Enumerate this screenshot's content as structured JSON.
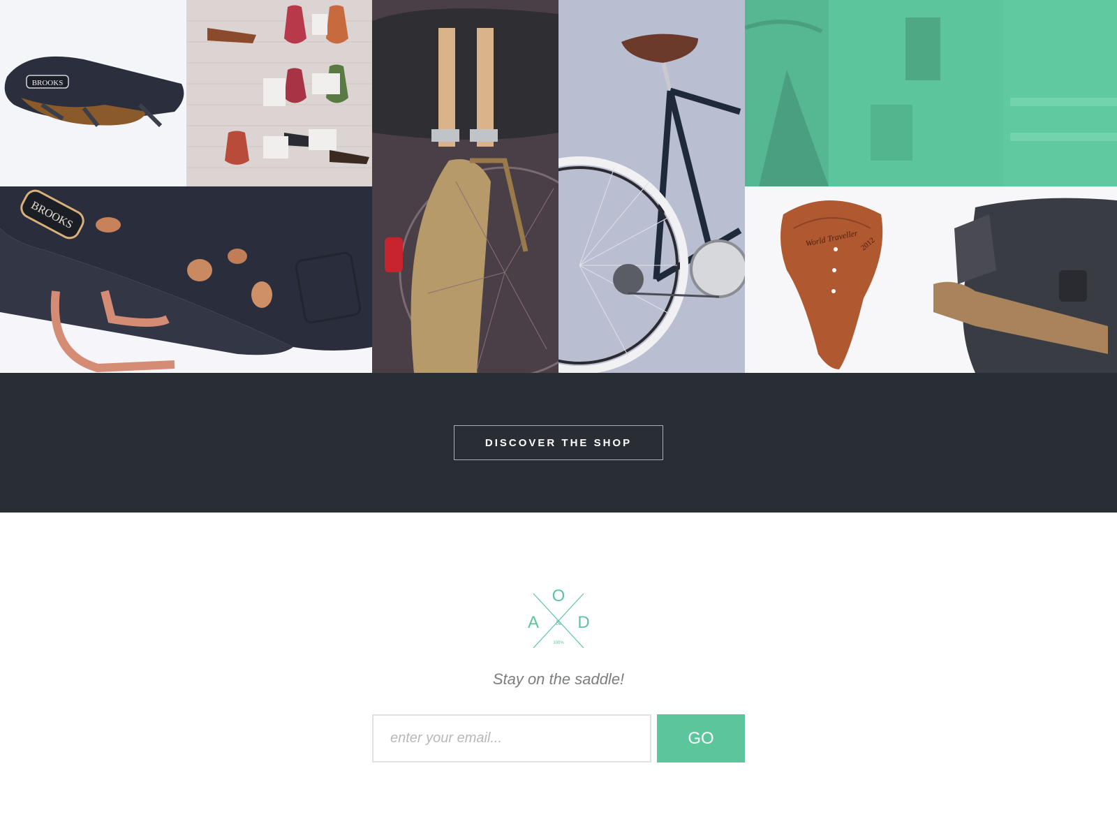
{
  "gallery": {
    "tiles": [
      {
        "subject": "black leather saddle with brand plate",
        "brand_text": "BROOKS"
      },
      {
        "subject": "wall display of coloured saddles"
      },
      {
        "subject": "bicycle rear rack with canvas bag and straps"
      },
      {
        "subject": "road bicycle with brown leather saddle"
      },
      {
        "subject": "shop interior with green overlay"
      },
      {
        "subject": "close-up of black saddle with copper rivets",
        "brand_text": "BROOKS"
      },
      {
        "subject": "copper saddle and waxed canvas messenger bag",
        "engraving_text": "World Traveller",
        "engraving_year": "2012"
      }
    ]
  },
  "cta": {
    "shop_label": "DISCOVER THE SHOP"
  },
  "logo": {
    "top": "O",
    "left": "A",
    "right": "D",
    "amp": "&",
    "sub": "100%"
  },
  "newsletter": {
    "tagline": "Stay on the saddle!",
    "email_placeholder": "enter your email...",
    "submit_label": "GO"
  },
  "colors": {
    "accent": "#5cc59b",
    "dark_band": "#282e33",
    "tagline": "#7b7d80",
    "input_border": "#e1e1e1"
  }
}
